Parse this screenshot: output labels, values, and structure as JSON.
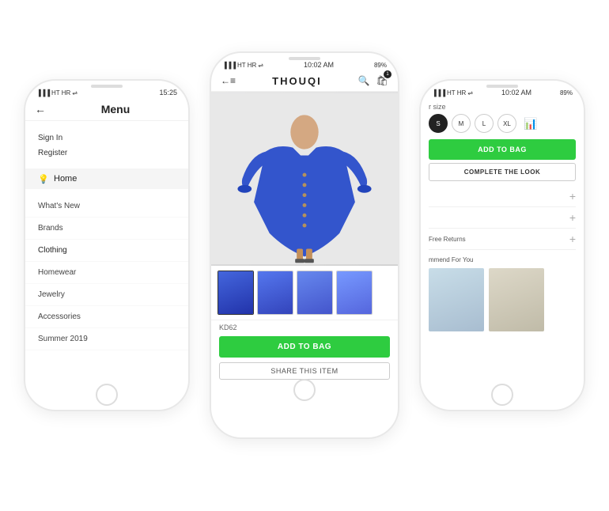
{
  "phones": {
    "left": {
      "status_bar": {
        "carrier": "HT HR",
        "time": "15:25"
      },
      "nav": {
        "back_label": "←",
        "title": "Menu"
      },
      "auth": {
        "sign_in": "Sign In",
        "register": "Register"
      },
      "home_item": {
        "label": "Home"
      },
      "nav_items": [
        "What's New",
        "Brands",
        "Clothing",
        "Homewear",
        "Jewelry",
        "Accessories",
        "Summer 2019"
      ]
    },
    "center": {
      "status_bar": {
        "carrier": "HT HR",
        "time": "10:02 AM",
        "battery": "89%"
      },
      "brand": "THOUQI",
      "product_sku": "KD62",
      "add_to_bag_label": "ADD TO BAG",
      "share_label": "SHARE THIS ITEM"
    },
    "right": {
      "size_label": "r size",
      "sizes": [
        "S",
        "M",
        "L",
        "XL"
      ],
      "selected_size": "S",
      "add_to_bag_label": "ADD TO BAG",
      "complete_look_label": "COMPLETE THE LOOK",
      "expandable_items": [
        "",
        "",
        "Free Returns"
      ],
      "recommend_label": "mmend For You"
    }
  }
}
